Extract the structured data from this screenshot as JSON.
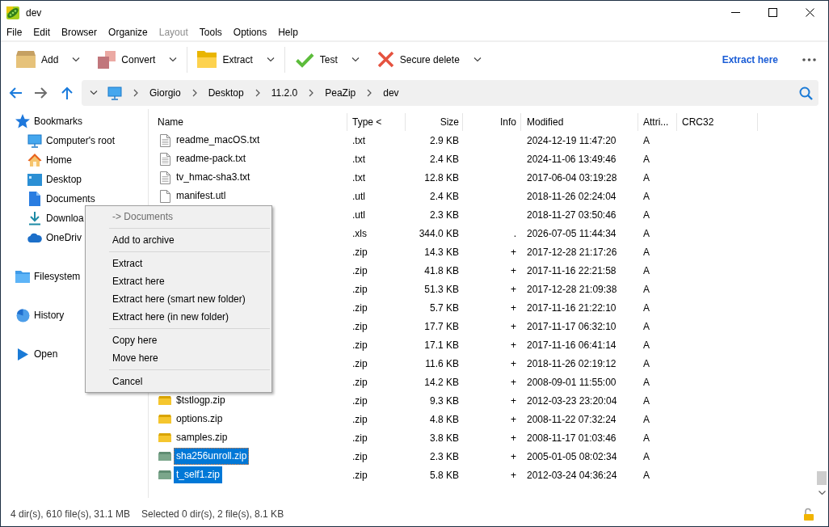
{
  "window": {
    "title": "dev"
  },
  "menu_bar": [
    {
      "label": "File",
      "disabled": false
    },
    {
      "label": "Edit",
      "disabled": false
    },
    {
      "label": "Browser",
      "disabled": false
    },
    {
      "label": "Organize",
      "disabled": false
    },
    {
      "label": "Layout",
      "disabled": true
    },
    {
      "label": "Tools",
      "disabled": false
    },
    {
      "label": "Options",
      "disabled": false
    },
    {
      "label": "Help",
      "disabled": false
    }
  ],
  "toolbar": {
    "groups": [
      [
        {
          "label": "Add"
        },
        {
          "label": "Convert"
        }
      ],
      [
        {
          "label": "Extract"
        }
      ],
      [
        {
          "label": "Test"
        },
        {
          "label": "Secure delete"
        }
      ]
    ],
    "quick_action": "Extract here"
  },
  "navigation": {
    "buttons": [
      {
        "disabled": false
      },
      {
        "disabled": true
      },
      {
        "disabled": false
      }
    ],
    "path": [
      "Giorgio",
      "Desktop",
      "11.2.0",
      "PeaZip",
      "dev"
    ]
  },
  "sidebar": {
    "items": [
      {
        "label": "Bookmarks",
        "children": [
          {
            "label": "Computer's root"
          },
          {
            "label": "Home"
          },
          {
            "label": "Desktop"
          },
          {
            "label": "Documents"
          },
          {
            "label": "Downloa"
          },
          {
            "label": "OneDriv"
          }
        ]
      },
      {
        "label": "Filesystem"
      },
      {
        "label": "History"
      },
      {
        "label": "Open"
      }
    ]
  },
  "file_list": {
    "columns": [
      "Name",
      "Type <",
      "Size",
      "Info",
      "Modified",
      "Attri...",
      "CRC32"
    ],
    "rows": [
      {
        "kind": "text",
        "name": "readme_macOS.txt",
        "type": ".txt",
        "size": "2.9 KB",
        "modified": "2024-12-19 11:47:20",
        "attributes": "A",
        "selected": false,
        "focused": false
      },
      {
        "kind": "text",
        "name": "readme-pack.txt",
        "type": ".txt",
        "size": "2.4 KB",
        "modified": "2024-11-06 13:49:46",
        "attributes": "A",
        "selected": false,
        "focused": false
      },
      {
        "kind": "text",
        "name": "tv_hmac-sha3.txt",
        "type": ".txt",
        "size": "12.8 KB",
        "modified": "2017-06-04 03:19:28",
        "attributes": "A",
        "selected": false,
        "focused": false
      },
      {
        "kind": "plain",
        "name": "manifest.utl",
        "type": ".utl",
        "size": "2.4 KB",
        "modified": "2018-11-26 02:24:04",
        "attributes": "A",
        "selected": false,
        "focused": false
      },
      {
        "type": ".utl",
        "size": "2.3 KB",
        "modified": "2018-11-27 03:50:46",
        "attributes": "A"
      },
      {
        "type": ".xls",
        "size": "344.0 KB",
        "info": ".",
        "modified": "2026-07-05 11:44:34",
        "attributes": "A"
      },
      {
        "type": ".zip",
        "size": "14.3 KB",
        "info": "+",
        "modified": "2017-12-28 21:17:26",
        "attributes": "A"
      },
      {
        "type": ".zip",
        "size": "41.8 KB",
        "info": "+",
        "modified": "2017-11-16 22:21:58",
        "attributes": "A"
      },
      {
        "type": ".zip",
        "size": "51.3 KB",
        "info": "+",
        "modified": "2017-12-28 21:09:38",
        "attributes": "A"
      },
      {
        "type": ".zip",
        "size": "5.7 KB",
        "info": "+",
        "modified": "2017-11-16 21:22:10",
        "attributes": "A"
      },
      {
        "type": ".zip",
        "size": "17.7 KB",
        "info": "+",
        "modified": "2017-11-17 06:32:10",
        "attributes": "A"
      },
      {
        "type": ".zip",
        "size": "17.1 KB",
        "info": "+",
        "modified": "2017-11-16 06:41:14",
        "attributes": "A"
      },
      {
        "type": ".zip",
        "size": "11.6 KB",
        "info": "+",
        "modified": "2018-11-26 02:19:12",
        "attributes": "A"
      },
      {
        "type": ".zip",
        "size": "14.2 KB",
        "info": "+",
        "modified": "2008-09-01 11:55:00",
        "attributes": "A"
      },
      {
        "kind": "archive",
        "name": "$tstlogp.zip",
        "type": ".zip",
        "size": "9.3 KB",
        "info": "+",
        "modified": "2012-03-23 23:20:04",
        "attributes": "A",
        "selected": false,
        "focused": false
      },
      {
        "kind": "archive",
        "name": "options.zip",
        "type": ".zip",
        "size": "4.8 KB",
        "info": "+",
        "modified": "2008-11-22 07:32:24",
        "attributes": "A",
        "selected": false,
        "focused": false
      },
      {
        "kind": "archive",
        "name": "samples.zip",
        "type": ".zip",
        "size": "3.8 KB",
        "info": "+",
        "modified": "2008-11-17 01:03:46",
        "attributes": "A",
        "selected": false,
        "focused": false
      },
      {
        "kind": "special",
        "name": "sha256unroll.zip",
        "type": ".zip",
        "size": "2.3 KB",
        "info": "+",
        "modified": "2005-01-05 08:02:34",
        "attributes": "A",
        "selected": true,
        "focused": true
      },
      {
        "kind": "special",
        "name": "t_self1.zip",
        "type": ".zip",
        "size": "5.8 KB",
        "info": "+",
        "modified": "2012-03-24 04:36:24",
        "attributes": "A",
        "selected": true,
        "focused": false
      }
    ]
  },
  "context_menu": {
    "groups": [
      [
        {
          "label": "-> Documents",
          "disabled": true
        }
      ],
      [
        {
          "label": "Add to archive",
          "disabled": false
        }
      ],
      [
        {
          "label": "Extract",
          "disabled": false
        },
        {
          "label": "Extract here",
          "disabled": false
        },
        {
          "label": "Extract here (smart new folder)",
          "disabled": false
        },
        {
          "label": "Extract here (in new folder)",
          "disabled": false
        }
      ],
      [
        {
          "label": "Copy here",
          "disabled": false
        },
        {
          "label": "Move here",
          "disabled": false
        }
      ],
      [
        {
          "label": "Cancel",
          "disabled": false
        }
      ]
    ]
  },
  "status_bar": {
    "totals": "4 dir(s), 610 file(s), 31.1 MB",
    "selection": "Selected 0 dir(s), 2 file(s), 8.1 KB"
  }
}
